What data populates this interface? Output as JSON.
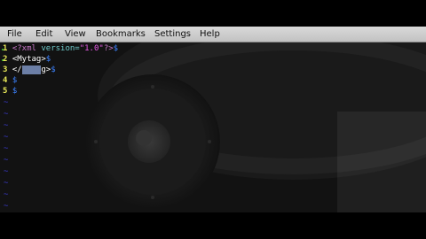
{
  "menu": {
    "file": "File",
    "edit": "Edit",
    "view": "View",
    "bookmarks": "Bookmarks",
    "settings": "Settings",
    "help": "Help"
  },
  "editor": {
    "lines": [
      {
        "num": "1",
        "text": "<?xml version=\"1.0\"?>$"
      },
      {
        "num": "2",
        "text": "<Mytag>$"
      },
      {
        "num": "3",
        "text": "</Mytag>$"
      },
      {
        "num": "4",
        "text": "$"
      },
      {
        "num": "5",
        "text": "$"
      }
    ],
    "line1": {
      "num": "1",
      "pi_open": "<?xml",
      "attr": " version=",
      "val": "\"1.0\"",
      "pi_close": "?>",
      "eol": "$"
    },
    "line2": {
      "num": "2",
      "tag": "<Mytag>",
      "eol": "$"
    },
    "line3": {
      "num": "3",
      "tag_open": "</",
      "selected": "Myta",
      "tag_rest": "g>",
      "eol": "$"
    },
    "line4": {
      "num": "4",
      "eol": "$"
    },
    "line5": {
      "num": "5",
      "eol": "$"
    },
    "empty_marker": "~",
    "empty_line_count": 10
  },
  "colors": {
    "menubar": "#c8c8c8",
    "editor_bg": "#121212",
    "line_number": "#e8e858",
    "eol_marker": "#3c82ff",
    "tilde": "#3a3acc",
    "selection": "#6c7fa6"
  }
}
